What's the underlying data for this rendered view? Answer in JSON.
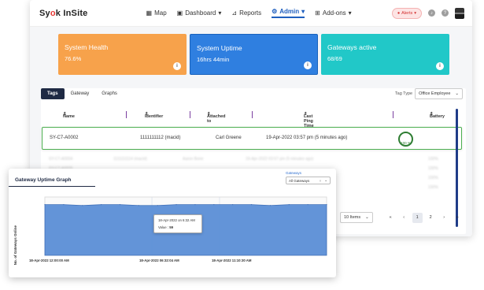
{
  "app": {
    "logo_prefix": "Sy",
    "logo_o": "o",
    "logo_suffix": "k InSite",
    "nav": [
      {
        "label": "Map"
      },
      {
        "label": "Dashboard"
      },
      {
        "label": "Reports"
      },
      {
        "label": "Admin"
      },
      {
        "label": "Add-ons"
      }
    ],
    "alerts_label": "Alerts"
  },
  "cards": [
    {
      "title": "System Health",
      "value": "76.6%",
      "color": "#f7a24b"
    },
    {
      "title": "System Uptime",
      "value": "16hrs 44min",
      "color": "#2f7fe0"
    },
    {
      "title": "Gateways active",
      "value": "68/69",
      "color": "#21c8c8"
    }
  ],
  "tabs": [
    "Tags",
    "Gateway",
    "Graphs"
  ],
  "tag_type": {
    "label": "Tag Type",
    "value": "Office Employee"
  },
  "table": {
    "headers": [
      "Name",
      "Identifier",
      "Attached to",
      "Last Ping Time",
      "Battery"
    ],
    "highlighted_row": {
      "name": "SY-C7-A0002",
      "identifier": "1111111112 (macid)",
      "attached_to": "Carl Greene",
      "last_ping": "19-Apr-2022 03:57 pm (5 minutes ago)",
      "battery": "100 %"
    },
    "blurred_rows": [
      {
        "name": "SY-C7-A0004",
        "identifier": "1111111114 (macid)",
        "attached_to": "Aaron Bone",
        "last_ping": "19-Apr-2022 03:57 pm (5 minutes ago)",
        "battery": "100%"
      },
      {
        "name": "SY-C7-A0005",
        "identifier": "",
        "attached_to": "",
        "last_ping": "",
        "battery": "100%"
      },
      {
        "name": "",
        "identifier": "",
        "attached_to": "",
        "last_ping": "",
        "battery": "100%"
      },
      {
        "name": "",
        "identifier": "",
        "attached_to": "",
        "last_ping": "",
        "battery": "100%"
      }
    ]
  },
  "pagination": {
    "per_page": "10 Items",
    "first": "«",
    "prev": "‹",
    "pages": [
      "1",
      "2"
    ],
    "current": "1",
    "next": "›",
    "last": "»"
  },
  "graph": {
    "title": "Gateway Uptime Graph",
    "gateways_label": "Gateways",
    "gateways_value": "All Gateways",
    "tooltip_time": "18-Apr-2022 on 6:32 AM",
    "tooltip_value_label": "Value",
    "tooltip_value": "59"
  },
  "chart_data": {
    "type": "area",
    "title": "Gateway Uptime Graph",
    "ylabel": "No. of Gateways Online",
    "xlabel": "",
    "x_ticks": [
      "18-Apr-2022 12:00:00 AM",
      "18-Apr-2022 06:32:04 AM",
      "18-Apr-2022 11:10:30 AM"
    ],
    "ylim": [
      0,
      69
    ],
    "series": [
      {
        "values": [
          60,
          60,
          59,
          60,
          60,
          59,
          59,
          60,
          60,
          60,
          60,
          60,
          59,
          60,
          60,
          60
        ]
      }
    ],
    "fill_color": "#5b8ed6",
    "grid": true
  }
}
